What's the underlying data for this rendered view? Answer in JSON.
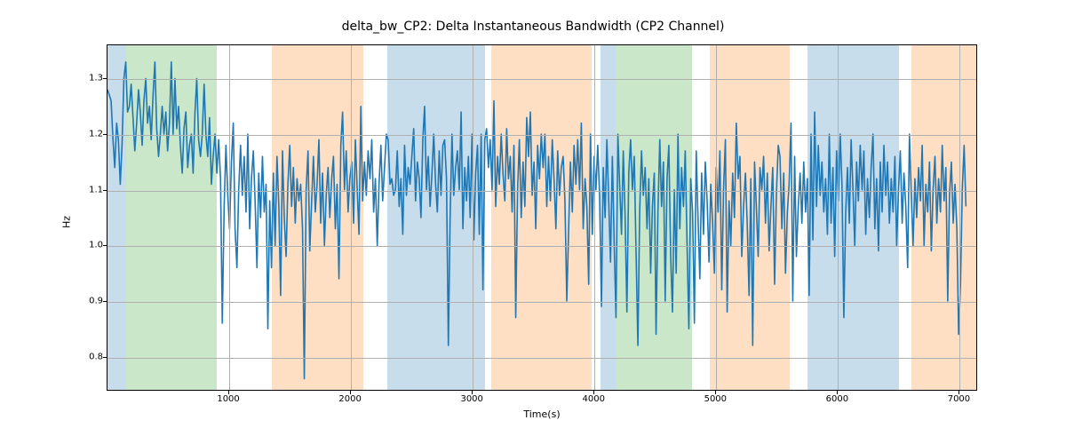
{
  "chart_data": {
    "type": "line",
    "title": "delta_bw_CP2: Delta Instantaneous Bandwidth (CP2 Channel)",
    "xlabel": "Time(s)",
    "ylabel": "Hz",
    "xlim": [
      0,
      7150
    ],
    "ylim": [
      0.74,
      1.36
    ],
    "xticks": [
      1000,
      2000,
      3000,
      4000,
      5000,
      6000,
      7000
    ],
    "yticks": [
      0.8,
      0.9,
      1.0,
      1.1,
      1.2,
      1.3
    ],
    "bands": [
      {
        "start": 0,
        "end": 150,
        "color": "blue"
      },
      {
        "start": 150,
        "end": 900,
        "color": "green"
      },
      {
        "start": 1350,
        "end": 1870,
        "color": "orange"
      },
      {
        "start": 1870,
        "end": 2100,
        "color": "orange"
      },
      {
        "start": 2300,
        "end": 3000,
        "color": "blue"
      },
      {
        "start": 3000,
        "end": 3100,
        "color": "blue"
      },
      {
        "start": 3150,
        "end": 3980,
        "color": "orange"
      },
      {
        "start": 4050,
        "end": 4170,
        "color": "blue"
      },
      {
        "start": 4170,
        "end": 4800,
        "color": "green"
      },
      {
        "start": 4950,
        "end": 5600,
        "color": "orange"
      },
      {
        "start": 5750,
        "end": 6500,
        "color": "blue"
      },
      {
        "start": 6600,
        "end": 7150,
        "color": "orange"
      }
    ],
    "series_x_step": 15,
    "series_y": [
      1.28,
      1.27,
      1.26,
      1.19,
      1.14,
      1.22,
      1.19,
      1.11,
      1.18,
      1.3,
      1.33,
      1.24,
      1.25,
      1.29,
      1.23,
      1.17,
      1.22,
      1.28,
      1.24,
      1.18,
      1.26,
      1.3,
      1.22,
      1.25,
      1.19,
      1.27,
      1.33,
      1.21,
      1.16,
      1.2,
      1.25,
      1.2,
      1.24,
      1.17,
      1.22,
      1.33,
      1.2,
      1.3,
      1.21,
      1.25,
      1.18,
      1.13,
      1.21,
      1.24,
      1.14,
      1.18,
      1.2,
      1.13,
      1.24,
      1.3,
      1.19,
      1.16,
      1.2,
      1.29,
      1.2,
      1.16,
      1.23,
      1.11,
      1.16,
      1.2,
      1.13,
      1.19,
      1.12,
      0.86,
      1.07,
      1.18,
      1.09,
      1.03,
      1.15,
      1.22,
      1.03,
      0.96,
      1.1,
      1.18,
      1.09,
      1.16,
      1.06,
      1.2,
      1.03,
      1.12,
      1.17,
      1.08,
      0.96,
      1.13,
      1.05,
      1.16,
      1.06,
      1.11,
      0.85,
      1.08,
      0.96,
      1.13,
      1.0,
      1.16,
      1.07,
      0.91,
      1.17,
      1.05,
      0.98,
      1.11,
      1.18,
      1.07,
      1.14,
      1.04,
      1.12,
      1.08,
      1.11,
      1.03,
      0.76,
      1.1,
      1.17,
      0.99,
      1.08,
      1.16,
      1.06,
      1.11,
      1.19,
      1.04,
      1.13,
      1.0,
      1.09,
      1.14,
      1.05,
      1.12,
      1.16,
      1.03,
      1.11,
      0.94,
      1.18,
      1.24,
      1.1,
      1.17,
      1.06,
      1.12,
      1.15,
      1.04,
      1.19,
      1.1,
      1.02,
      1.25,
      1.08,
      1.15,
      1.09,
      1.17,
      1.12,
      1.19,
      1.06,
      1.12,
      1.0,
      1.11,
      1.18,
      1.08,
      1.14,
      1.2,
      1.19,
      1.11,
      1.12,
      1.09,
      1.1,
      1.17,
      1.07,
      1.12,
      1.02,
      1.18,
      1.09,
      1.14,
      1.11,
      1.16,
      1.21,
      1.08,
      1.15,
      1.12,
      1.05,
      1.19,
      1.25,
      1.1,
      1.16,
      1.07,
      1.13,
      1.2,
      1.11,
      1.06,
      1.17,
      1.09,
      1.18,
      1.19,
      1.12,
      0.82,
      1.05,
      1.2,
      1.09,
      1.14,
      1.17,
      1.1,
      1.24,
      1.03,
      1.14,
      1.08,
      1.16,
      1.05,
      1.2,
      1.01,
      1.13,
      1.18,
      1.02,
      1.2,
      0.92,
      1.19,
      1.21,
      1.14,
      1.19,
      1.1,
      1.26,
      1.07,
      1.16,
      1.11,
      1.2,
      1.13,
      1.08,
      1.21,
      1.12,
      1.16,
      1.06,
      1.18,
      0.87,
      1.1,
      1.19,
      1.05,
      1.15,
      1.07,
      1.23,
      1.16,
      1.24,
      1.09,
      1.15,
      1.03,
      1.18,
      1.12,
      1.2,
      1.14,
      1.2,
      1.07,
      1.16,
      1.08,
      1.19,
      1.12,
      1.03,
      1.17,
      1.09,
      1.14,
      1.16,
      1.08,
      0.9,
      1.03,
      1.15,
      1.06,
      1.18,
      1.11,
      1.19,
      1.1,
      1.22,
      1.03,
      1.12,
      1.07,
      0.93,
      1.2,
      1.02,
      1.16,
      1.1,
      1.18,
      1.09,
      0.89,
      1.14,
      1.05,
      1.19,
      1.08,
      0.97,
      1.16,
      1.0,
      0.87,
      1.2,
      1.11,
      1.02,
      1.17,
      1.05,
      0.88,
      1.13,
      1.19,
      1.1,
      1.16,
      0.99,
      0.82,
      1.06,
      1.17,
      1.09,
      1.14,
      1.03,
      1.12,
      0.95,
      1.07,
      1.13,
      0.84,
      1.06,
      1.19,
      1.07,
      1.15,
      0.9,
      1.12,
      1.18,
      0.98,
      0.88,
      1.1,
      0.95,
      1.2,
      1.03,
      1.14,
      1.07,
      1.17,
      1.0,
      0.85,
      1.12,
      1.06,
      0.86,
      1.17,
      1.05,
      0.94,
      1.13,
      1.02,
      1.15,
      1.08,
      0.97,
      1.11,
      1.04,
      0.95,
      1.14,
      1.06,
      1.17,
      0.92,
      1.1,
      1.19,
      0.88,
      1.08,
      1.0,
      1.13,
      1.05,
      1.22,
      1.12,
      1.16,
      0.98,
      1.07,
      1.13,
      1.04,
      0.91,
      1.12,
      0.82,
      1.15,
      1.07,
      0.98,
      1.14,
      1.1,
      1.16,
      1.04,
      1.13,
      0.99,
      1.07,
      1.14,
      0.93,
      1.09,
      1.18,
      1.16,
      1.03,
      1.13,
      0.95,
      1.06,
      1.11,
      1.22,
      0.9,
      1.16,
      0.98,
      1.07,
      1.13,
      1.04,
      1.15,
      1.06,
      1.12,
      0.91,
      1.2,
      1.01,
      1.24,
      1.07,
      1.18,
      1.09,
      1.15,
      1.06,
      1.12,
      1.02,
      1.2,
      1.04,
      1.14,
      0.98,
      1.17,
      1.08,
      1.2,
      1.11,
      0.87,
      1.06,
      1.14,
      1.04,
      1.19,
      1.1,
      1.0,
      1.15,
      1.08,
      1.18,
      1.1,
      1.17,
      1.02,
      1.12,
      1.05,
      1.14,
      1.2,
      1.03,
      1.12,
      0.99,
      1.15,
      1.06,
      1.18,
      1.09,
      1.15,
      1.04,
      1.12,
      1.06,
      1.16,
      1.0,
      1.1,
      1.17,
      1.04,
      1.13,
      1.07,
      0.96,
      1.2,
      1.09,
      1.0,
      1.12,
      1.05,
      1.14,
      1.08,
      1.18,
      1.0,
      1.11,
      1.06,
      1.15,
      0.99,
      1.1,
      1.16,
      1.04,
      1.12,
      1.06,
      1.18,
      1.08,
      1.14,
      0.9,
      1.09,
      1.15,
      1.04,
      1.11,
      1.03,
      0.84,
      0.93,
      1.1,
      1.18,
      1.07
    ]
  }
}
